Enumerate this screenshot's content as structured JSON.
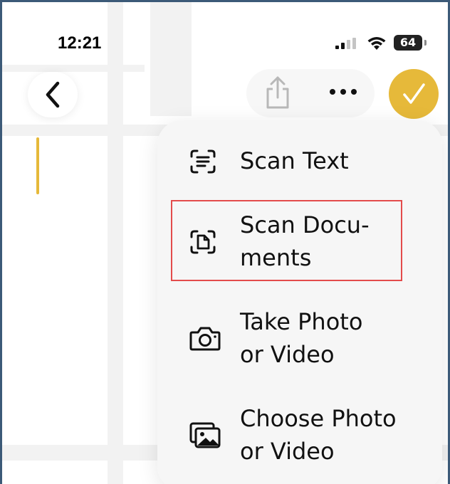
{
  "status_bar": {
    "time": "12:21",
    "battery": "64"
  },
  "nav": {
    "back_icon": "chevron-left-icon",
    "share_icon": "share-icon",
    "more_icon": "ellipsis-icon",
    "done_icon": "checkmark-icon"
  },
  "colors": {
    "accent": "#e6b93a",
    "highlight": "#e34b4b"
  },
  "menu": {
    "items": [
      {
        "label_lines": [
          "Scan Text"
        ],
        "icon": "scan-text-icon"
      },
      {
        "label_lines": [
          "Scan Docu-",
          "ments"
        ],
        "icon": "scan-document-icon"
      },
      {
        "label_lines": [
          "Take Photo",
          "or Video"
        ],
        "icon": "camera-icon"
      },
      {
        "label_lines": [
          "Choose Photo",
          "or Video"
        ],
        "icon": "photo-library-icon"
      }
    ]
  }
}
